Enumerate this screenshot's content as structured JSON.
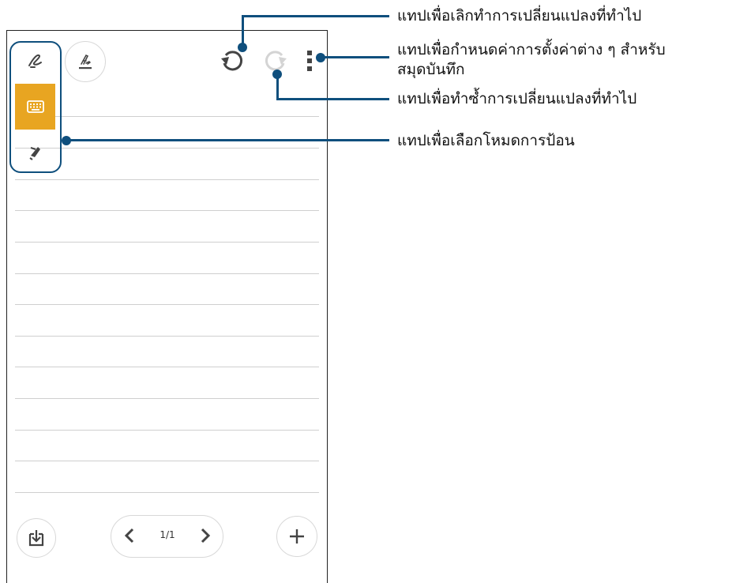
{
  "toolbar": {
    "handwriting_icon": "handwriting-icon",
    "pen_settings_icon": "pen-style-icon",
    "undo_icon": "undo-icon",
    "redo_icon": "redo-icon",
    "more_icon": "more-vertical-icon"
  },
  "input_modes": {
    "handwriting": "handwriting-mode-icon",
    "keyboard": "keyboard-mode-icon",
    "pen": "pen-mode-icon",
    "active": "keyboard",
    "active_color": "#e8a521"
  },
  "footer": {
    "import_icon": "import-page-icon",
    "page_indicator": "1/1",
    "prev_icon": "chevron-left-icon",
    "next_icon": "chevron-right-icon",
    "add_icon": "plus-icon"
  },
  "callouts": {
    "undo": "แทปเพื่อเลิกทำการเปลี่ยนแปลงที่ทำไป",
    "settings_line1": "แทปเพื่อกำหนดค่าการตั้งค่าต่าง ๆ สำหรับ",
    "settings_line2": "สมุดบันทึก",
    "redo": "แทปเพื่อทำซ้ำการเปลี่ยนแปลงที่ทำไป",
    "input_mode": "แทปเพื่อเลือกโหมดการป้อน"
  },
  "colors": {
    "callout": "#0f4f7d",
    "accent": "#e8a521"
  }
}
